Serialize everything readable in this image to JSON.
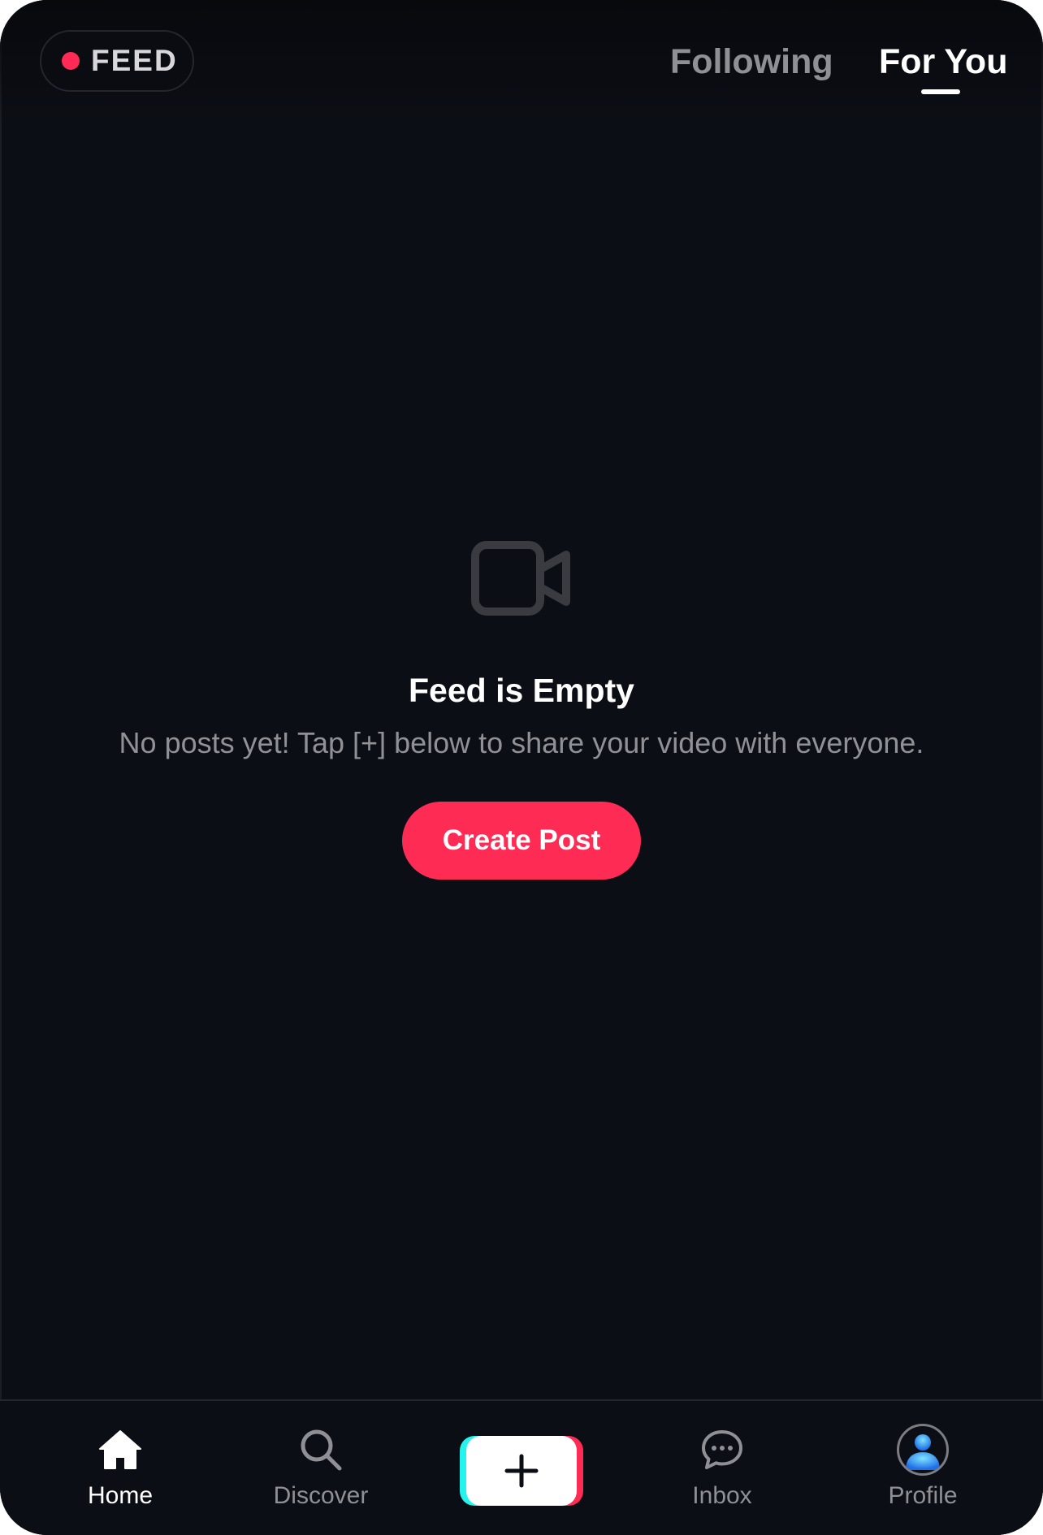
{
  "header": {
    "feed_label": "FEED",
    "tabs": [
      {
        "label": "Following",
        "active": false
      },
      {
        "label": "For You",
        "active": true
      }
    ]
  },
  "empty_state": {
    "icon": "video-camera-icon",
    "title": "Feed is Empty",
    "description": "No posts yet! Tap [+] below to share your video with everyone.",
    "button_label": "Create Post"
  },
  "bottom_nav": {
    "items": [
      {
        "label": "Home",
        "icon": "home-icon",
        "active": true
      },
      {
        "label": "Discover",
        "icon": "search-icon",
        "active": false
      },
      {
        "label": "",
        "icon": "plus-icon",
        "active": false
      },
      {
        "label": "Inbox",
        "icon": "chat-bubble-icon",
        "active": false
      },
      {
        "label": "Profile",
        "icon": "avatar-icon",
        "active": false
      }
    ]
  },
  "colors": {
    "background": "#0c0e15",
    "accent": "#fe2c55",
    "accent_secondary": "#25f4ee",
    "text_primary": "#ffffff",
    "text_secondary": "#8f9095"
  }
}
